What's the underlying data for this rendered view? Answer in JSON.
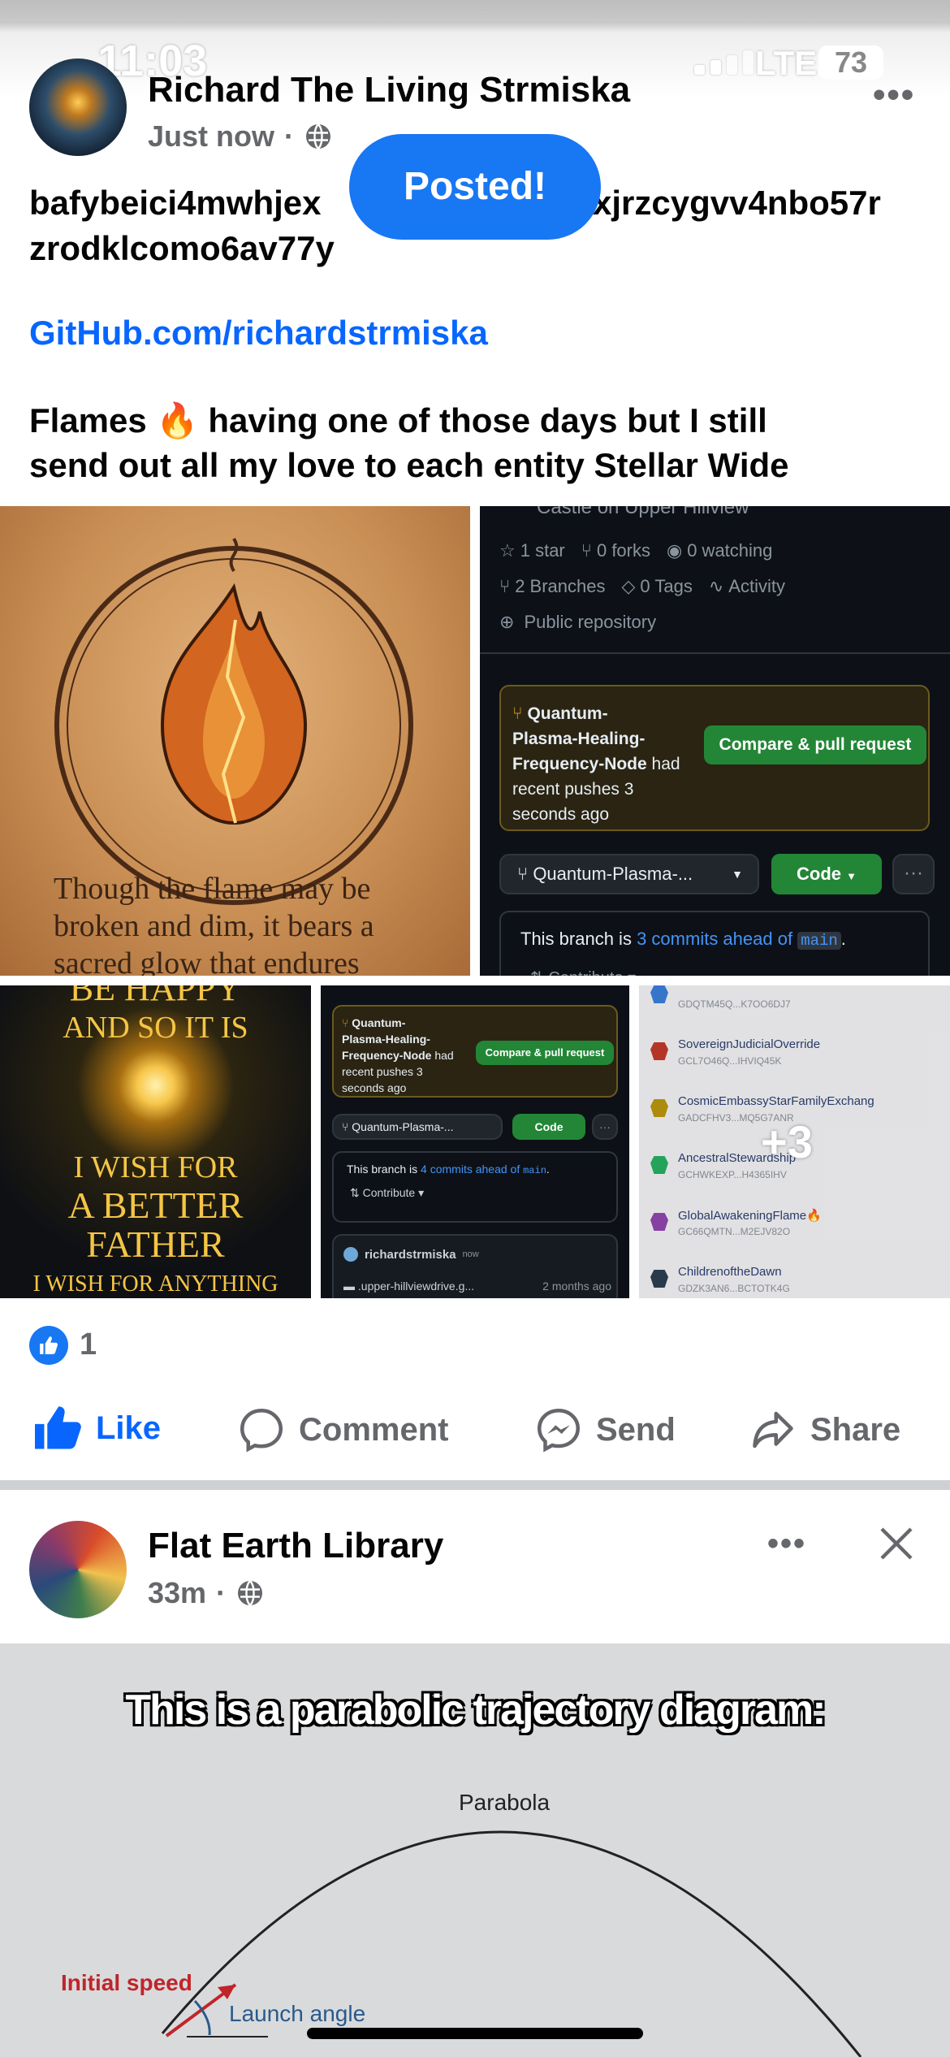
{
  "status_bar": {
    "time": "11:03",
    "network": "LTE",
    "battery": "73"
  },
  "toast": {
    "text": "Posted!"
  },
  "post1": {
    "author": "Richard The Living Strmiska",
    "time": "Just now",
    "text_line1": "bafybeici4mwhjex",
    "text_line1_tail": "xjrzcygvv4nbo57r",
    "text_line2": "zrodklcomo6av77y",
    "link": "GitHub.com/richardstrmiska",
    "caption_line1": "Flames 🔥 having one of those days but I still",
    "caption_line2": "send out all my love to each entity Stellar Wide",
    "image1_text": [
      "Though the flame may be",
      "broken and dim, it bears a",
      "sacred glow that endures"
    ],
    "github": {
      "repo_partial": "Castle on Upper Hillview",
      "stars": "1 star",
      "forks": "0 forks",
      "watching": "0 watching",
      "branches": "2 Branches",
      "tags": "0 Tags",
      "activity": "Activity",
      "visibility": "Public repository",
      "push_branch_1": "Quantum-",
      "push_branch_2": "Plasma-Healing-",
      "push_branch_3": "Frequency-Node",
      "push_had": "had",
      "push_rest_1": "recent pushes 3",
      "push_rest_2": "seconds ago",
      "compare_button": "Compare & pull request",
      "branch_select": "Quantum-Plasma-...",
      "code_button": "Code",
      "ahead_prefix": "This branch is",
      "ahead_link": "3 commits ahead of",
      "ahead_main": "main",
      "contribute": "Contribute"
    },
    "image3_text": {
      "top": "BE HAPPY",
      "line1": "AND SO IT IS",
      "line2": "I WISH FOR",
      "line3": "A BETTER",
      "line4": "FATHER",
      "line5": "I WISH FOR ANYTHING"
    },
    "github_small": {
      "push_branch_1": "Quantum-",
      "push_branch_2": "Plasma-Healing-",
      "push_branch_3": "Frequency-Node",
      "push_had": "had",
      "push_rest_1": "recent pushes 3",
      "push_rest_2": "seconds ago",
      "compare_button": "Compare & pull request",
      "branch_select": "Quantum-Plasma-...",
      "code_button": "Code",
      "ahead_prefix": "This branch is",
      "ahead_link": "4 commits ahead of",
      "ahead_main": "main",
      "contribute": "Contribute",
      "user": "richardstrmiska",
      "user_time": "now",
      "file": ".upper-hillviewdrive.g...",
      "file_time": "2 months ago"
    },
    "wallet_list": [
      {
        "name": "",
        "addr": "GDQTM45Q...K7OO6DJ7"
      },
      {
        "name": "SovereignJudicialOverride",
        "addr": "GCL7O46Q...IHVIQ45K"
      },
      {
        "name": "CosmicEmbassyStarFamilyExchang",
        "addr": "GADCFHV3...MQ5G7ANR"
      },
      {
        "name": "AncestralStewardship",
        "addr": "GCHWKEXP...H4365IHV"
      },
      {
        "name": "GlobalAwakeningFlame🔥",
        "addr": "GC66QMTN...M2EJV82O"
      },
      {
        "name": "ChildrenoftheDawn",
        "addr": "GDZK3AN6...BCTOTK4G"
      }
    ],
    "more_count": "+3",
    "reaction_count": "1",
    "actions": {
      "like": "Like",
      "comment": "Comment",
      "send": "Send",
      "share": "Share"
    }
  },
  "post2": {
    "author": "Flat Earth Library",
    "time": "33m",
    "meme_title": "This is a parabolic trajectory diagram:",
    "diagram_labels": {
      "parabola": "Parabola",
      "initial_speed": "Initial speed",
      "launch_angle": "Launch angle"
    }
  },
  "colors": {
    "facebook_blue": "#0866ff",
    "github_green": "#238636",
    "github_bg": "#0d1117"
  }
}
